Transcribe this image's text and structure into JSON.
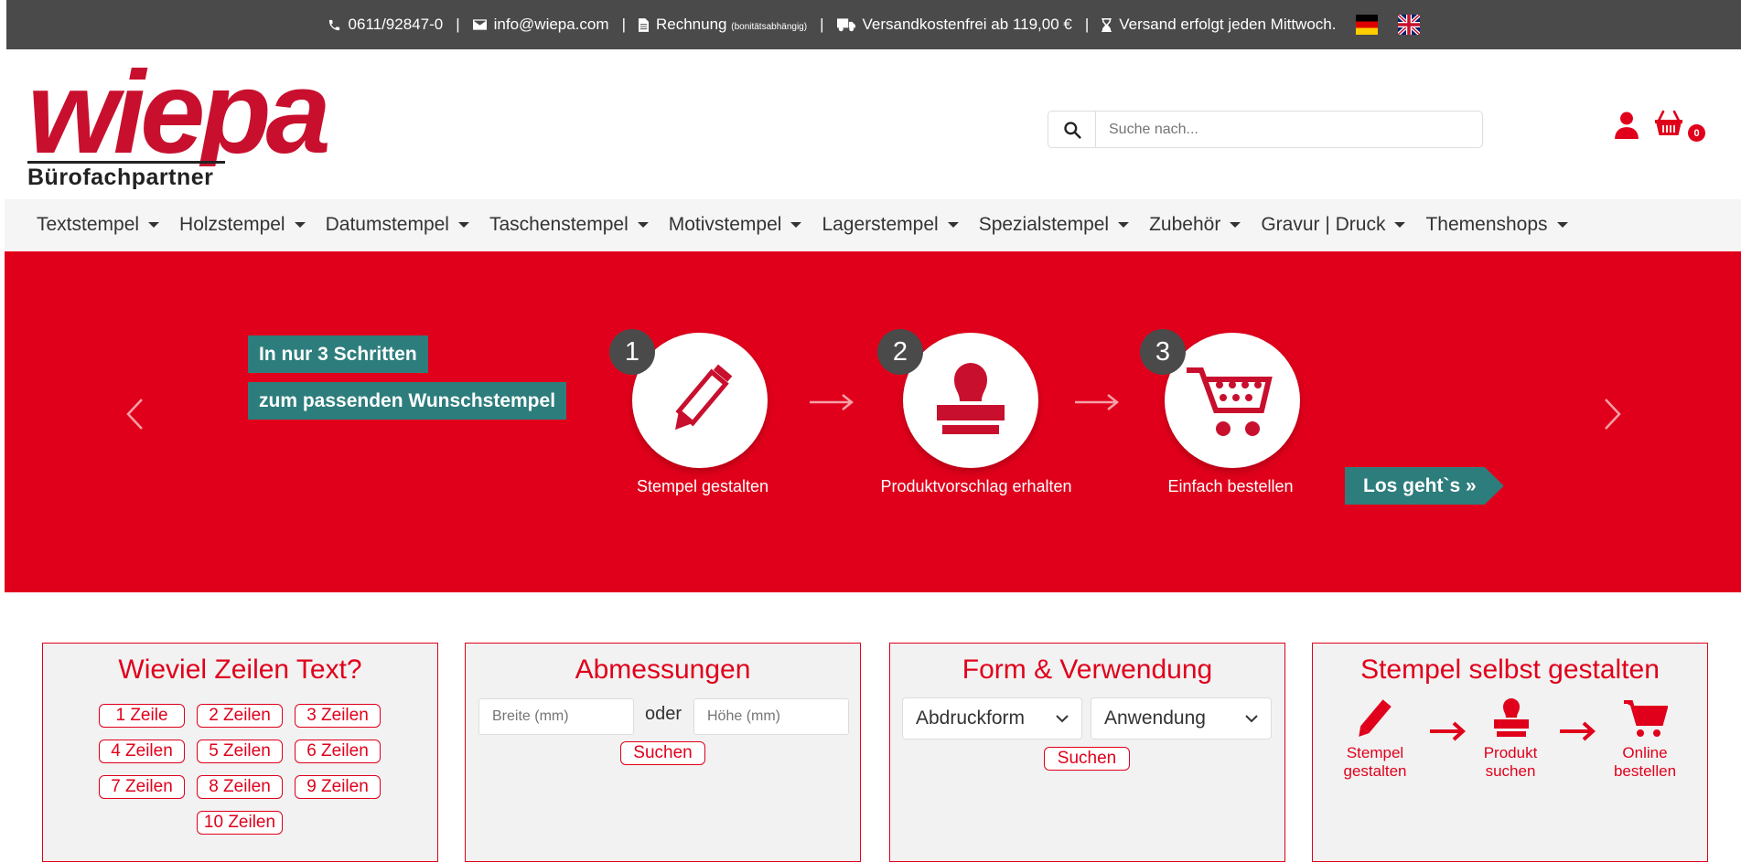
{
  "topbar": {
    "phone": "0611/92847-0",
    "email": "info@wiepa.com",
    "invoice": "Rechnung",
    "invoice_note": "(bonitätsabhängig)",
    "shipping_free": "Versandkostenfrei ab 119,00 €",
    "shipping_day": "Versand erfolgt jeden Mittwoch.",
    "separator": "|"
  },
  "logo": {
    "text": "wiepa",
    "tagline": "Bürofachpartner"
  },
  "search": {
    "placeholder": "Suche nach..."
  },
  "cart": {
    "count": "0"
  },
  "nav": {
    "items": [
      "Textstempel",
      "Holzstempel",
      "Datumstempel",
      "Taschenstempel",
      "Motivstempel",
      "Lagerstempel",
      "Spezialstempel",
      "Zubehör",
      "Gravur | Druck",
      "Themenshops"
    ]
  },
  "hero": {
    "tag1": "In nur 3 Schritten",
    "tag2": "zum passenden Wunschstempel",
    "steps": [
      {
        "num": "1",
        "label": "Stempel gestalten"
      },
      {
        "num": "2",
        "label": "Produktvorschlag erhalten"
      },
      {
        "num": "3",
        "label": "Einfach bestellen"
      }
    ],
    "cta": "Los geht`s »"
  },
  "box_lines": {
    "title": "Wieviel Zeilen Text?",
    "options": [
      "1 Zeile",
      "2 Zeilen",
      "3 Zeilen",
      "4 Zeilen",
      "5 Zeilen",
      "6 Zeilen",
      "7 Zeilen",
      "8 Zeilen",
      "9 Zeilen",
      "10 Zeilen"
    ]
  },
  "box_size": {
    "title": "Abmessungen",
    "width_placeholder": "Breite (mm)",
    "or": "oder",
    "height_placeholder": "Höhe (mm)",
    "search_label": "Suchen"
  },
  "box_form": {
    "title": "Form & Verwendung",
    "shape_select": "Abdruckform",
    "use_select": "Anwendung",
    "search_label": "Suchen"
  },
  "box_design": {
    "title": "Stempel selbst gestalten",
    "steps": [
      {
        "line1": "Stempel",
        "line2": "gestalten"
      },
      {
        "line1": "Produkt",
        "line2": "suchen"
      },
      {
        "line1": "Online",
        "line2": "bestellen"
      }
    ]
  },
  "colors": {
    "brand_red": "#e0001b",
    "teal": "#2e7d7d",
    "dark_gray": "#4a4a4a"
  }
}
